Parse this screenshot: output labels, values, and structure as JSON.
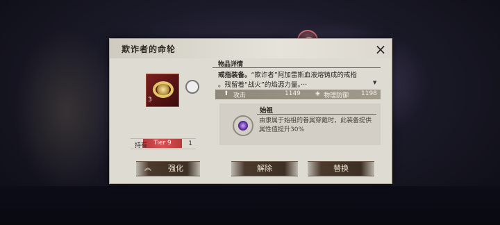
{
  "dialog": {
    "title": "欺诈者的命轮",
    "close_icon": "×"
  },
  "item": {
    "tier": "Tier 9",
    "level": "3",
    "owned_label": "持有",
    "owned_count": "1"
  },
  "details": {
    "heading": "物品详情",
    "desc_prefix": "戒指装备。",
    "desc_line1": "“欺诈者”阿加雷斯血液熔铸成的戒指",
    "desc_line2": "。残留着“战火”的焰源力量。···",
    "stats": [
      {
        "icon": "⬆",
        "label": "攻击",
        "value": "1149"
      },
      {
        "icon": "◈",
        "label": "物理防御",
        "value": "1198"
      }
    ]
  },
  "skill": {
    "name": "始祖",
    "description": "由隶属于始祖的眷属穿戴时，此装备提供属性值提升30%"
  },
  "buttons": {
    "enhance_icon": "︽",
    "enhance": "强化",
    "remove": "解除",
    "replace": "替换"
  }
}
